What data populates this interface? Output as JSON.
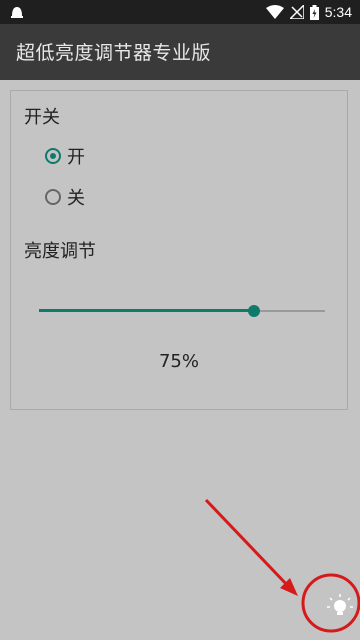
{
  "status_bar": {
    "time": "5:34",
    "icons": [
      "notification-icon",
      "wifi-icon",
      "no-signal-icon",
      "battery-icon"
    ]
  },
  "app_bar": {
    "title": "超低亮度调节器专业版"
  },
  "switch_section": {
    "label": "开关",
    "options": [
      {
        "label": "开",
        "checked": true
      },
      {
        "label": "关",
        "checked": false
      }
    ]
  },
  "brightness": {
    "label": "亮度调节",
    "value": 0.75,
    "percent_text": "75%"
  },
  "colors": {
    "accent": "#0f7a6a",
    "annotation_red": "#d41a1a",
    "background": "#c4c4c4",
    "app_bar": "#3a3a3a"
  },
  "fab_icon": "brightness-bulb-icon"
}
